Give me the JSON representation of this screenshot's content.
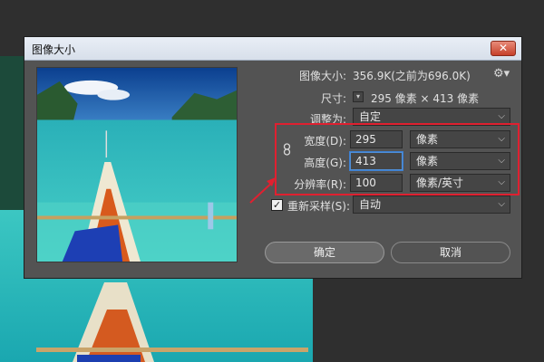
{
  "dialog": {
    "title": "图像大小",
    "close_label": "✕",
    "image_size_label": "图像大小:",
    "image_size_value": "356.9K(之前为696.0K)",
    "dimensions_label": "尺寸:",
    "dimensions_value": "295 像素 × 413 像素",
    "fit_to_label": "调整为:",
    "fit_to_value": "自定",
    "width_label": "宽度(D):",
    "width_value": "295",
    "width_unit": "像素",
    "height_label": "高度(G):",
    "height_value": "413",
    "height_unit": "像素",
    "resolution_label": "分辨率(R):",
    "resolution_value": "100",
    "resolution_unit": "像素/英寸",
    "resample_label": "重新采样(S):",
    "resample_value": "自动",
    "resample_checked": "✓",
    "ok_label": "确定",
    "cancel_label": "取消"
  },
  "icons": {
    "gear": "gear-icon",
    "link": "chain-link-icon",
    "chevron": "chevron-down-icon"
  },
  "colors": {
    "annotation": "#e02030",
    "dialog_bg": "#535353",
    "field_focus": "#4f8fd8"
  }
}
